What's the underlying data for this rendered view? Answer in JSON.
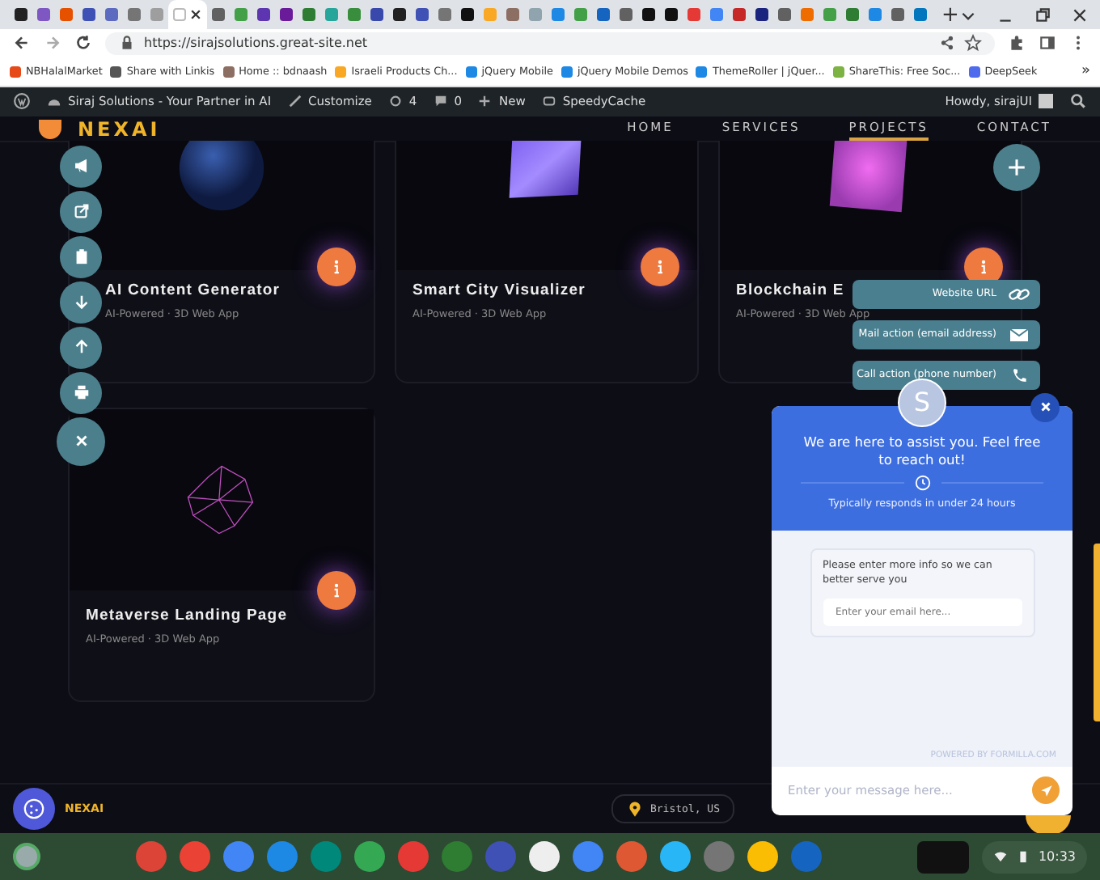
{
  "browser": {
    "tabs": [
      {
        "color": "#222222",
        "selected": false
      },
      {
        "color": "#7e57c2",
        "selected": false
      },
      {
        "color": "#e65100",
        "selected": false
      },
      {
        "color": "#3f51b5",
        "selected": false
      },
      {
        "color": "#5c6bc0",
        "selected": false
      },
      {
        "color": "#757575",
        "selected": false
      },
      {
        "color": "#9e9e9e",
        "selected": false
      },
      {
        "color": "#ffffff",
        "selected": true
      },
      {
        "color": "#616161",
        "selected": false
      },
      {
        "color": "#43a047",
        "selected": false
      },
      {
        "color": "#5e35b1",
        "selected": false
      },
      {
        "color": "#6a1b9a",
        "selected": false
      },
      {
        "color": "#2e7d32",
        "selected": false
      },
      {
        "color": "#26a69a",
        "selected": false
      },
      {
        "color": "#388e3c",
        "selected": false
      },
      {
        "color": "#3949ab",
        "selected": false
      },
      {
        "color": "#212121",
        "selected": false
      },
      {
        "color": "#3f51b5",
        "selected": false
      },
      {
        "color": "#757575",
        "selected": false
      },
      {
        "color": "#111111",
        "selected": false
      },
      {
        "color": "#f9a825",
        "selected": false
      },
      {
        "color": "#8d6e63",
        "selected": false
      },
      {
        "color": "#90a4ae",
        "selected": false
      },
      {
        "color": "#1e88e5",
        "selected": false
      },
      {
        "color": "#43a047",
        "selected": false
      },
      {
        "color": "#1565c0",
        "selected": false
      },
      {
        "color": "#616161",
        "selected": false
      },
      {
        "color": "#111111",
        "selected": false
      },
      {
        "color": "#111111",
        "selected": false
      },
      {
        "color": "#e53935",
        "selected": false
      },
      {
        "color": "#4285f4",
        "selected": false
      },
      {
        "color": "#c62828",
        "selected": false
      },
      {
        "color": "#1a237e",
        "selected": false
      },
      {
        "color": "#616161",
        "selected": false
      },
      {
        "color": "#ef6c00",
        "selected": false
      },
      {
        "color": "#43a047",
        "selected": false
      },
      {
        "color": "#2e7d32",
        "selected": false
      },
      {
        "color": "#1e88e5",
        "selected": false
      },
      {
        "color": "#616161",
        "selected": false
      },
      {
        "color": "#0277bd",
        "selected": false
      }
    ],
    "new_tab": "+",
    "url": "https://sirajsolutions.great-site.net",
    "bookmarks": [
      "NBHalalMarket",
      "Share with Linkis",
      "Home :: bdnaash",
      "Israeli Products Ch...",
      "jQuery Mobile",
      "jQuery Mobile Demos",
      "ThemeRoller | jQuer...",
      "ShareThis: Free Soc...",
      "DeepSeek"
    ],
    "bookmarks_more": "»"
  },
  "wp_admin_bar": {
    "site": "Siraj Solutions - Your Partner in AI",
    "customize": "Customize",
    "updates": "4",
    "comments": "0",
    "new": "New",
    "plugin": "SpeedyCache",
    "howdy": "Howdy, sirajUI"
  },
  "site": {
    "logo": "NEXAI",
    "nav": [
      {
        "label": "HOME",
        "selected": false
      },
      {
        "label": "SERVICES",
        "selected": false
      },
      {
        "label": "PROJECTS",
        "selected": true
      },
      {
        "label": "CONTACT",
        "selected": false
      }
    ]
  },
  "projects": [
    {
      "kind": "sphere",
      "title": "AI Content Generator",
      "subtitle": "AI-Powered · 3D Web App"
    },
    {
      "kind": "cylinder",
      "title": "Smart City Visualizer",
      "subtitle": "AI-Powered · 3D Web App"
    },
    {
      "kind": "cube",
      "title": "Blockchain E",
      "subtitle": "AI-Powered · 3D Web App"
    },
    {
      "kind": "wireframe",
      "title": "Metaverse Landing Page",
      "subtitle": "AI-Powered · 3D Web App"
    }
  ],
  "contact_menu": [
    {
      "kind": "link",
      "label": "Website URL"
    },
    {
      "kind": "mail",
      "label": "Mail action (email address)"
    },
    {
      "kind": "phone",
      "label": "Call action (phone number)"
    }
  ],
  "chat": {
    "avatar": "S",
    "title": "We are here to assist you. Feel free to reach out!",
    "response_time": "Typically responds in under 24 hours",
    "prompt": "Please enter more info so we can better serve you",
    "email_placeholder": "Enter your email here...",
    "powered_by": "POWERED BY FORMILLA.COM",
    "message_placeholder": "Enter your message here..."
  },
  "footer": {
    "logo": "NEXAI",
    "location": "Bristol, US"
  },
  "taskbar": {
    "apps": [
      {
        "color": "#db4437"
      },
      {
        "color": "#ea4335"
      },
      {
        "color": "#4285f4"
      },
      {
        "color": "#1e88e5"
      },
      {
        "color": "#00897b"
      },
      {
        "color": "#34a853"
      },
      {
        "color": "#e53935"
      },
      {
        "color": "#2e7d32"
      },
      {
        "color": "#3f51b5"
      },
      {
        "color": "#eeeeee"
      },
      {
        "color": "#4285f4"
      },
      {
        "color": "#de5833"
      },
      {
        "color": "#29b6f6"
      },
      {
        "color": "#757575"
      },
      {
        "color": "#fbbc04"
      },
      {
        "color": "#1565c0"
      }
    ],
    "time": "10:33"
  }
}
